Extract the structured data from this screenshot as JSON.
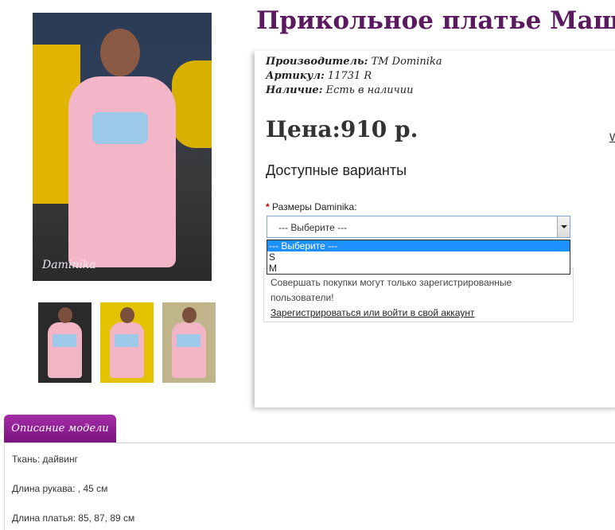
{
  "product": {
    "title": "Прикольное платье Маша",
    "manufacturer_label": "Производитель:",
    "manufacturer_value": "TM Dominika",
    "sku_label": "Артикул:",
    "sku_value": "11731 R",
    "availability_label": "Наличие:",
    "availability_value": "Есть в наличии",
    "price": "Цена:910 р.",
    "side_link": "W",
    "image_logo": "Daminika"
  },
  "options": {
    "heading": "Доступные варианты",
    "required_mark": "*",
    "size_label": "Размеры Daminika:",
    "select_value": "--- Выберите ---",
    "dropdown_items": [
      "--- Выберите ---",
      "S",
      "M"
    ]
  },
  "notice": {
    "text": "Совершать покупки могут только зарегистрированные пользователи!",
    "link": "Зарегистрироваться или войти в свой аккаунт"
  },
  "tabs": {
    "description_label": "Описание модели"
  },
  "description": {
    "fabric": "Ткань: дайвинг",
    "sleeve": "Длина рукава: , 45 см",
    "dress_length": "Длина платья: 85, 87, 89 см"
  }
}
